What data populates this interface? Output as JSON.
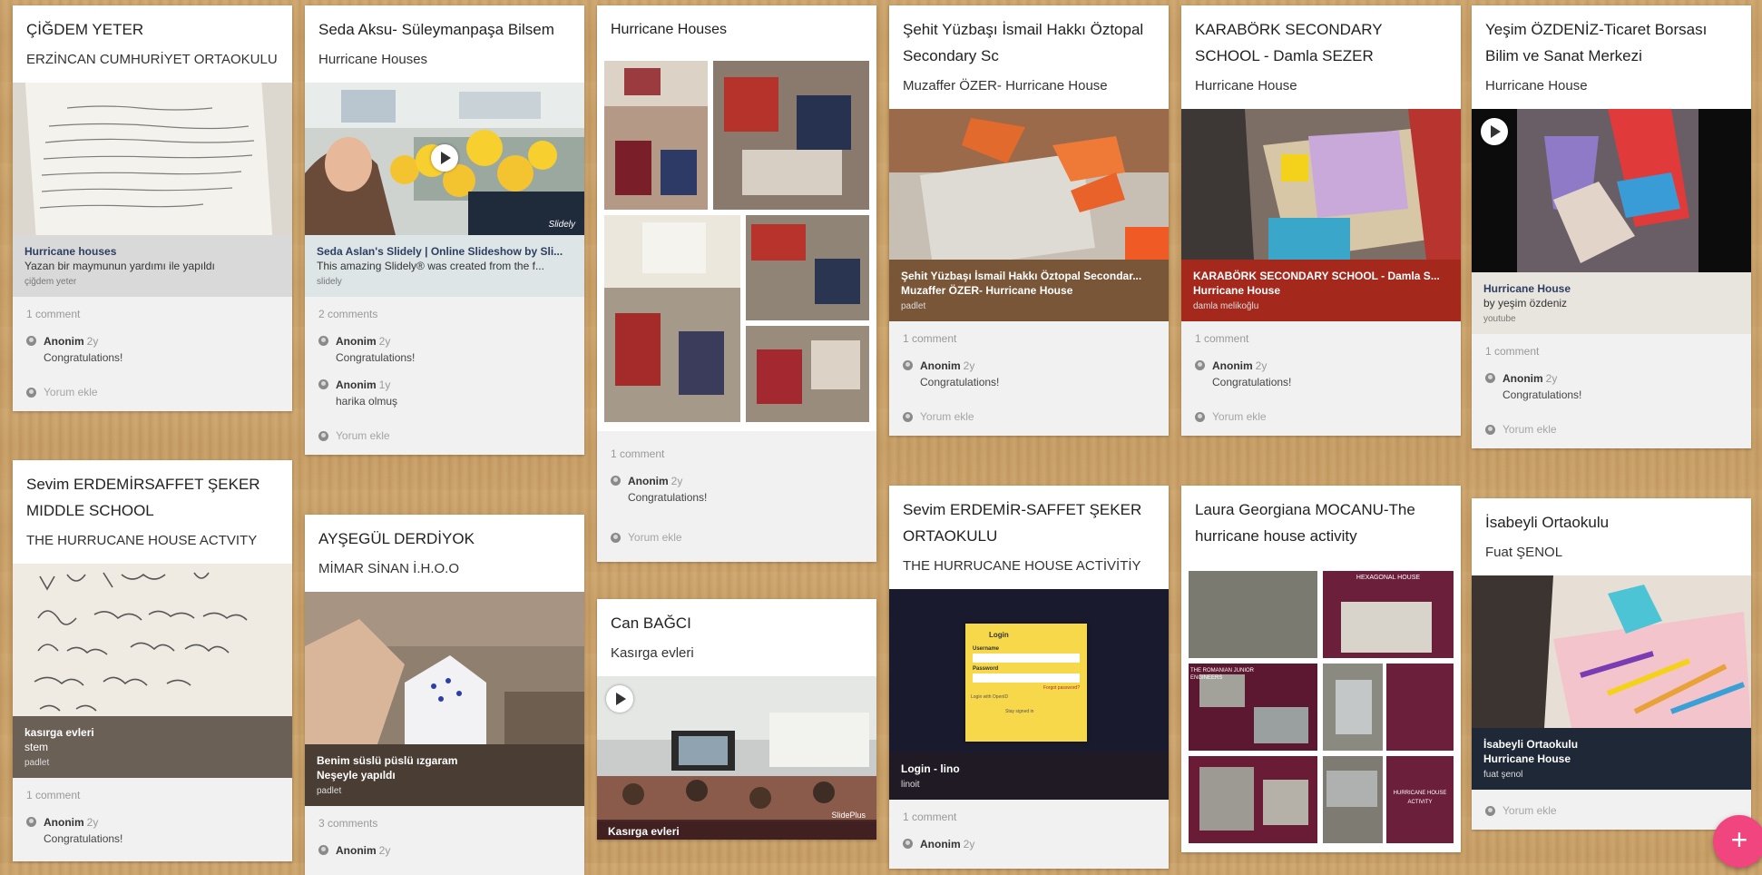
{
  "add_comment_label": "Yorum ekle",
  "cards": {
    "c1": {
      "title": "ÇİĞDEM YETER",
      "subtitle": "ERZİNCAN CUMHURİYET ORTAOKULU",
      "attachment": {
        "title": "Hurricane houses",
        "desc": "Yazan bir maymunun yardımı ile yapıldı",
        "source": "çiğdem yeter"
      },
      "comment_count": "1 comment",
      "comments": [
        {
          "author": "Anonim",
          "age": "2y",
          "text": "Congratulations!"
        }
      ]
    },
    "c2": {
      "title": "Seda Aksu- Süleymanpaşa Bilsem",
      "subtitle": "Hurricane Houses",
      "attachment": {
        "title": "Seda Aslan's Slidely | Online Slideshow by Sli...",
        "desc": "This amazing Slidely® was created from the f...",
        "source": "slidely",
        "watermark": "Slidely"
      },
      "comment_count": "2 comments",
      "comments": [
        {
          "author": "Anonim",
          "age": "2y",
          "text": "Congratulations!"
        },
        {
          "author": "Anonim",
          "age": "1y",
          "text": "harika olmuş"
        }
      ]
    },
    "c3": {
      "title": "Hurricane Houses",
      "comment_count": "1 comment",
      "comments": [
        {
          "author": "Anonim",
          "age": "2y",
          "text": "Congratulations!"
        }
      ]
    },
    "c4": {
      "title": "Şehit Yüzbaşı İsmail Hakkı Öztopal Secondary Sc",
      "subtitle": "Muzaffer ÖZER- Hurricane House",
      "attachment": {
        "title": "Şehit Yüzbaşı İsmail Hakkı Öztopal Secondar...",
        "desc": "Muzaffer ÖZER- Hurricane House",
        "source": "padlet"
      },
      "comment_count": "1 comment",
      "comments": [
        {
          "author": "Anonim",
          "age": "2y",
          "text": "Congratulations!"
        }
      ]
    },
    "c5": {
      "title": "KARABÖRK SECONDARY SCHOOL - Damla SEZER",
      "subtitle": "Hurricane House",
      "attachment": {
        "title": "KARABÖRK SECONDARY SCHOOL - Damla S...",
        "desc": "Hurricane House",
        "source": "damla melikoğlu"
      },
      "comment_count": "1 comment",
      "comments": [
        {
          "author": "Anonim",
          "age": "2y",
          "text": "Congratulations!"
        }
      ]
    },
    "c6": {
      "title": "Yeşim ÖZDENİZ-Ticaret Borsası Bilim ve Sanat Merkezi",
      "subtitle": "Hurricane House",
      "attachment": {
        "title": "Hurricane House",
        "desc": "by yeşim özdeniz",
        "source": "youtube"
      },
      "comment_count": "1 comment",
      "comments": [
        {
          "author": "Anonim",
          "age": "2y",
          "text": "Congratulations!"
        }
      ]
    },
    "c7": {
      "title": "Sevim ERDEMİRSAFFET ŞEKER MIDDLE SCHOOL",
      "subtitle": "THE HURRUCANE HOUSE ACTVITY",
      "attachment": {
        "title": "kasırga evleri",
        "desc": "stem",
        "source": "padlet"
      },
      "comment_count": "1 comment",
      "comments": [
        {
          "author": "Anonim",
          "age": "2y",
          "text": "Congratulations!"
        }
      ]
    },
    "c8": {
      "title": "AYŞEGÜL DERDİYOK",
      "subtitle": "MİMAR SİNAN İ.H.O.O",
      "attachment": {
        "title": "Benim süslü püslü ızgaram",
        "desc": "Neşeyle yapıldı",
        "source": "padlet"
      },
      "comment_count": "3 comments",
      "comments": [
        {
          "author": "Anonim",
          "age": "2y",
          "text": ""
        }
      ]
    },
    "c9": {
      "title": "Can BAĞCI",
      "subtitle": "Kasırga evleri",
      "attachment": {
        "title": "Kasırga evleri",
        "watermark": "SlidePlus"
      }
    },
    "c10": {
      "title": "Sevim ERDEMİR-SAFFET ŞEKER ORTAOKULU",
      "subtitle": "THE HURRUCANE HOUSE ACTİVİTİY",
      "attachment": {
        "title": "Login - lino",
        "source": "linoit"
      },
      "comment_count": "1 comment",
      "comments": [
        {
          "author": "Anonim",
          "age": "2y",
          "text": ""
        }
      ],
      "lino": {
        "login": "Login",
        "username": "Username",
        "password": "Password",
        "forgot": "Forgot password?",
        "stay": "Stay signed in",
        "signin": "Login with OpenID"
      }
    },
    "c11": {
      "title": "Laura Georgiana MOCANU-The hurricane house activity",
      "collage": {
        "hexagonal": "HEXAGONAL HOUSE",
        "romanian": "THE ROMANIAN JUNIOR ENGINEERS",
        "activity": "HURRICANE HOUSE ACTIVITY"
      }
    },
    "c12": {
      "title": "İsabeyli Ortaokulu",
      "subtitle": "Fuat ŞENOL",
      "attachment": {
        "title": "İsabeyli Ortaokulu",
        "desc": "Hurricane House",
        "source": "fuat şenol"
      }
    }
  },
  "fab_label": "+",
  "colors": {
    "background": "#c9a068",
    "fab": "#f0457e",
    "padlet_caption_brown": "#7a5638",
    "padlet_caption_red": "#a5281c"
  }
}
